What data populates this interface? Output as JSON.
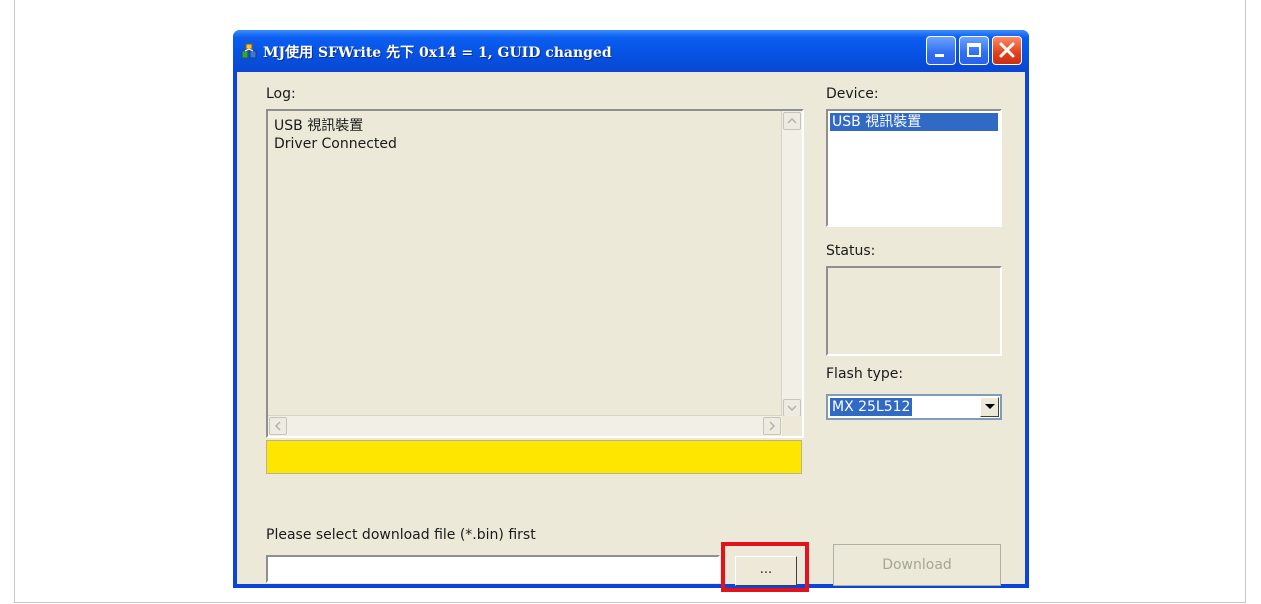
{
  "window": {
    "title": "MJ使用 SFWrite 先下 0x14 = 1, GUID changed"
  },
  "log": {
    "label": "Log:",
    "lines": [
      "USB 視訊裝置",
      "Driver Connected"
    ]
  },
  "device": {
    "label": "Device:",
    "items": [
      "USB 視訊裝置"
    ],
    "selected_index": 0
  },
  "status": {
    "label": "Status:",
    "value": ""
  },
  "flash": {
    "label": "Flash type:",
    "selected": "MX 25L512"
  },
  "download": {
    "prompt": "Please select download file (*.bin) first",
    "path_value": "",
    "browse_label": "...",
    "button_label": "Download"
  },
  "colors": {
    "progress_fill": "#ffe600",
    "highlight": "#e4131b",
    "selection": "#316ac5",
    "titlebar": "#0653e5"
  }
}
